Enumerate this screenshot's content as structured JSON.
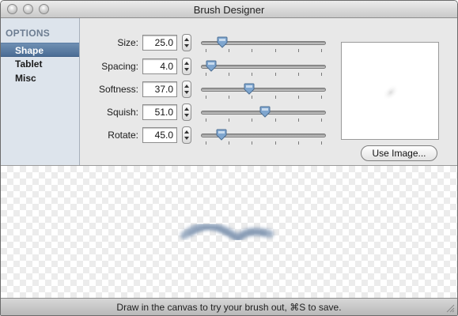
{
  "window": {
    "title": "Brush Designer"
  },
  "sidebar": {
    "header": "OPTIONS",
    "items": [
      {
        "label": "Shape",
        "selected": true
      },
      {
        "label": "Tablet",
        "selected": false
      },
      {
        "label": "Misc",
        "selected": false
      }
    ]
  },
  "controls": [
    {
      "label": "Size:",
      "value": "25.0",
      "fraction": 0.14
    },
    {
      "label": "Spacing:",
      "value": "4.0",
      "fraction": 0.04
    },
    {
      "label": "Softness:",
      "value": "37.0",
      "fraction": 0.37
    },
    {
      "label": "Squish:",
      "value": "51.0",
      "fraction": 0.51
    },
    {
      "label": "Rotate:",
      "value": "45.0",
      "fraction": 0.13
    }
  ],
  "preview": {
    "use_image_label": "Use Image..."
  },
  "statusbar": {
    "text": "Draw in the canvas to try your brush out, ⌘S to save."
  },
  "colors": {
    "selection": "#4b6d95",
    "sidebar_bg": "#dde4ec",
    "knob": "#7fa6cf"
  }
}
